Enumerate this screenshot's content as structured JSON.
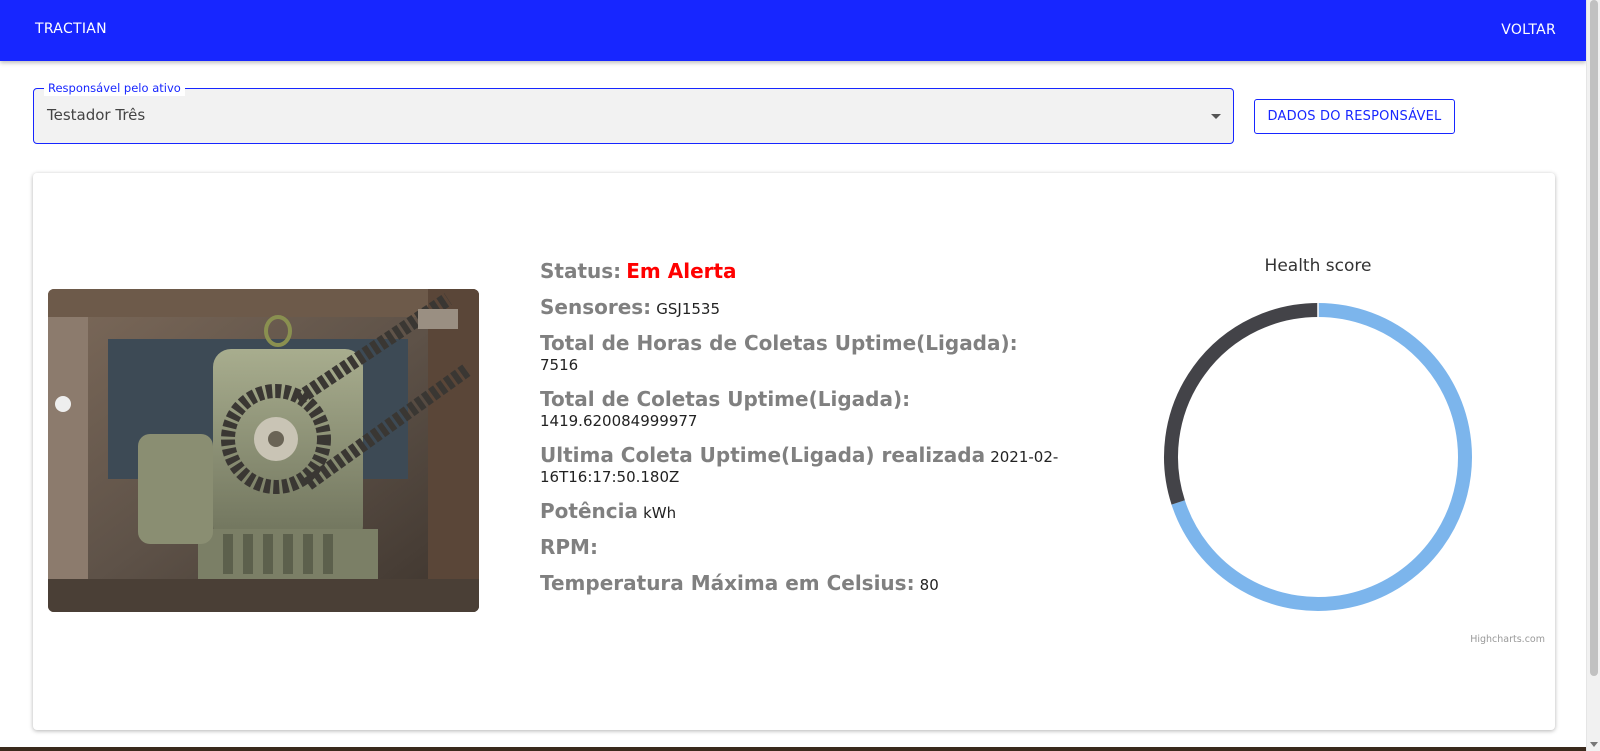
{
  "appbar": {
    "brand": "TRACTIAN",
    "back_label": "VOLTAR"
  },
  "responsible": {
    "legend": "Responsável pelo ativo",
    "selected": "Testador Três",
    "button_label": "DADOS DO RESPONSÁVEL"
  },
  "asset": {
    "status_label": "Status:",
    "status_value": "Em Alerta",
    "sensors_label": "Sensores:",
    "sensors_value": "GSJ1535",
    "total_hours_label": "Total de Horas de Coletas Uptime(Ligada):",
    "total_hours_value": "7516",
    "total_collects_label": "Total de Coletas Uptime(Ligada):",
    "total_collects_value": "1419.620084999977",
    "last_collect_label": "Ultima Coleta Uptime(Ligada) realizada",
    "last_collect_value": "2021-02-16T16:17:50.180Z",
    "power_label": "Potência",
    "power_value": "kWh",
    "rpm_label": "RPM:",
    "temp_label": "Temperatura Máxima em Celsius:",
    "temp_value": "80"
  },
  "colors": {
    "appbar": "#1726ff",
    "alert": "#ff0000",
    "score": "#7cb5ec",
    "remainder": "#434348"
  },
  "chart_data": {
    "type": "pie",
    "title": "Health score",
    "slices": [
      {
        "value": 70,
        "color": "#7cb5ec"
      },
      {
        "value": 30,
        "color": "#434348"
      }
    ],
    "credit": "Highcharts.com"
  }
}
